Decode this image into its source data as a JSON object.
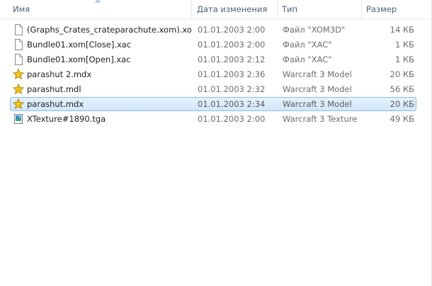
{
  "columns": {
    "name": "Имя",
    "date": "Дата изменения",
    "type": "Тип",
    "size": "Размер"
  },
  "files": [
    {
      "name": "(Graphs_Crates_crateparachute.xom).xo...",
      "date": "01.01.2003 2:00",
      "type": "Файл \"XOM3D\"",
      "size": "14 КБ",
      "icon": "document-icon"
    },
    {
      "name": "Bundle01.xom[Close].xac",
      "date": "01.01.2003 2:00",
      "type": "Файл \"XAC\"",
      "size": "1 КБ",
      "icon": "document-icon"
    },
    {
      "name": "Bundle01.xom[Open].xac",
      "date": "01.01.2003 2:12",
      "type": "Файл \"XAC\"",
      "size": "1 КБ",
      "icon": "document-icon"
    },
    {
      "name": "parashut 2.mdx",
      "date": "01.01.2003 2:36",
      "type": "Warcraft 3 Model",
      "size": "20 КБ",
      "icon": "star-icon"
    },
    {
      "name": "parashut.mdl",
      "date": "01.01.2003 2:32",
      "type": "Warcraft 3 Model",
      "size": "56 КБ",
      "icon": "star-icon"
    },
    {
      "name": "parashut.mdx",
      "date": "01.01.2003 2:34",
      "type": "Warcraft 3 Model",
      "size": "20 КБ",
      "icon": "star-icon",
      "selected": true
    },
    {
      "name": "XTexture#1890.tga",
      "date": "01.01.2003 2:00",
      "type": "Warcraft 3 Texture",
      "size": "49 КБ",
      "icon": "image-icon"
    }
  ],
  "colors": {
    "header_text": "#4c607a",
    "selection_fill": "#d3e7fa",
    "selection_border": "#8bbbe8",
    "star": "#f2c319"
  }
}
